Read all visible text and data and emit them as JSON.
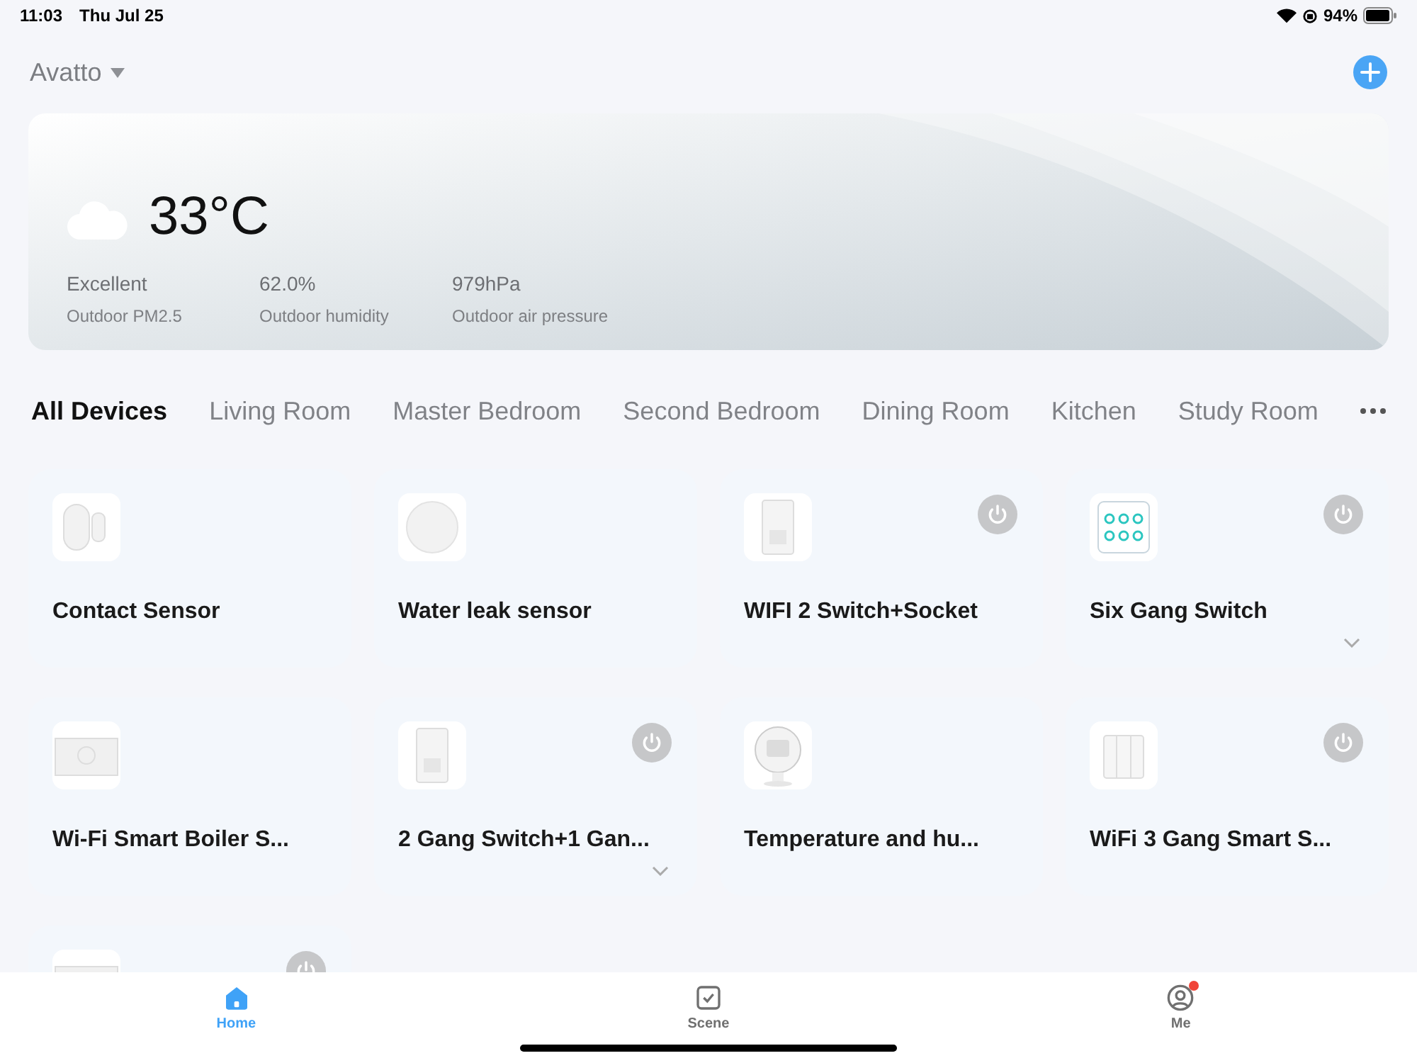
{
  "status_bar": {
    "time": "11:03",
    "date": "Thu Jul 25",
    "battery": "94%"
  },
  "header": {
    "home_name": "Avatto"
  },
  "weather": {
    "temperature": "33°C",
    "stats": [
      {
        "value": "Excellent",
        "label": "Outdoor PM2.5"
      },
      {
        "value": "62.0%",
        "label": "Outdoor humidity"
      },
      {
        "value": "979hPa",
        "label": "Outdoor air pressure"
      }
    ]
  },
  "rooms": [
    {
      "label": "All Devices",
      "selected": true
    },
    {
      "label": "Living Room",
      "selected": false
    },
    {
      "label": "Master Bedroom",
      "selected": false
    },
    {
      "label": "Second Bedroom",
      "selected": false
    },
    {
      "label": "Dining Room",
      "selected": false
    },
    {
      "label": "Kitchen",
      "selected": false
    },
    {
      "label": "Study Room",
      "selected": false
    }
  ],
  "devices": [
    {
      "name": "Contact Sensor",
      "kind": "contact",
      "power": false,
      "expandable": false
    },
    {
      "name": "Water leak sensor",
      "kind": "round",
      "power": false,
      "expandable": false
    },
    {
      "name": "WIFI 2 Switch+Socket",
      "kind": "socket",
      "power": true,
      "expandable": false
    },
    {
      "name": "Six Gang Switch",
      "kind": "six",
      "power": true,
      "expandable": true
    },
    {
      "name": "Wi-Fi Smart Boiler S...",
      "kind": "panel",
      "power": false,
      "expandable": false
    },
    {
      "name": "2 Gang Switch+1 Gan...",
      "kind": "socket",
      "power": true,
      "expandable": true
    },
    {
      "name": "Temperature and hu...",
      "kind": "thermo",
      "power": false,
      "expandable": false
    },
    {
      "name": "WiFi 3 Gang Smart S...",
      "kind": "three",
      "power": true,
      "expandable": false
    },
    {
      "kind": "panel",
      "power": true,
      "expandable": false
    }
  ],
  "tab_bar": [
    {
      "label": "Home",
      "kind": "home",
      "selected": true,
      "badge": false
    },
    {
      "label": "Scene",
      "kind": "scene",
      "selected": false,
      "badge": false
    },
    {
      "label": "Me",
      "kind": "me",
      "selected": false,
      "badge": true
    }
  ]
}
